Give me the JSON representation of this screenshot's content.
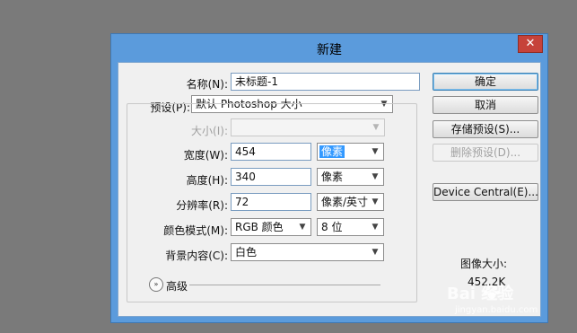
{
  "dialog": {
    "title": "新建",
    "close_glyph": "✕"
  },
  "form": {
    "name": {
      "label": "名称(N):",
      "value": "未标题-1"
    },
    "preset": {
      "label": "预设(P):",
      "value": "默认 Photoshop 大小"
    },
    "size": {
      "label": "大小(I):",
      "value": ""
    },
    "width": {
      "label": "宽度(W):",
      "value": "454",
      "unit": "像素"
    },
    "height": {
      "label": "高度(H):",
      "value": "340",
      "unit": "像素"
    },
    "resolution": {
      "label": "分辨率(R):",
      "value": "72",
      "unit": "像素/英寸"
    },
    "color_mode": {
      "label": "颜色模式(M):",
      "value": "RGB 颜色",
      "depth": "8 位"
    },
    "background": {
      "label": "背景内容(C):",
      "value": "白色"
    },
    "advanced": {
      "label": "高级",
      "icon": "»"
    }
  },
  "buttons": {
    "ok": "确定",
    "cancel": "取消",
    "save_preset": "存储预设(S)...",
    "delete_preset": "删除预设(D)...",
    "device_central": "Device Central(E)..."
  },
  "info": {
    "image_size_label": "图像大小:",
    "image_size_value": "452.2K"
  },
  "watermark": {
    "brand": "Bai 经验",
    "url": "jingyan.baidu.com"
  },
  "colors": {
    "title_bar": "#5b9bdc",
    "client_bg": "#f0f0f0",
    "close_button": "#c6423a",
    "selection": "#3399ff"
  }
}
